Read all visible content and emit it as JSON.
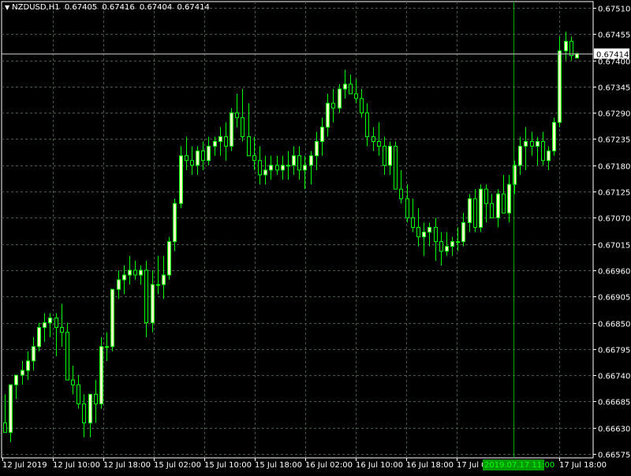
{
  "header": {
    "symbol_tf": "NZDUSD,H1",
    "open": "0.67405",
    "high": "0.67416",
    "low": "0.67404",
    "close": "0.67414"
  },
  "colors": {
    "background": "#000000",
    "grid": "#4a5a4a",
    "bull_candle_fill": "#ffffc8",
    "bull_wick": "#00ff00",
    "bear_candle_fill": "#000000",
    "bear_outline": "#00ff00",
    "axis_text": "#ffffff",
    "price_line": "#c0c0c0",
    "time_marker_line": "#00aa00",
    "time_marker_label_bg": "#009900"
  },
  "chart_data": {
    "type": "candlestick",
    "symbol": "NZDUSD",
    "timeframe": "H1",
    "current_price_label": "0.67414",
    "time_marker_label": "2019.07.17 11:00",
    "y_axis": {
      "ticks": [
        "0.67510",
        "0.67455",
        "0.67400",
        "0.67345",
        "0.67290",
        "0.67235",
        "0.67180",
        "0.67125",
        "0.67070",
        "0.67015",
        "0.66960",
        "0.66905",
        "0.66850",
        "0.66795",
        "0.66740",
        "0.66685",
        "0.66630",
        "0.66575"
      ],
      "ylim": [
        0.66575,
        0.6752
      ]
    },
    "x_axis": {
      "labels": [
        "12 Jul 2019",
        "12 Jul 10:00",
        "12 Jul 18:00",
        "15 Jul 02:00",
        "15 Jul 10:00",
        "15 Jul 18:00",
        "16 Jul 02:00",
        "16 Jul 10:00",
        "16 Jul 18:00",
        "17 Jul 02:00",
        "17 Jul 18:00"
      ]
    },
    "grid": true,
    "candles": [
      [
        0.6664,
        0.667,
        0.6662,
        0.6662
      ],
      [
        0.6662,
        0.6672,
        0.666,
        0.6672
      ],
      [
        0.6672,
        0.6674,
        0.6669,
        0.6674
      ],
      [
        0.6674,
        0.6677,
        0.6672,
        0.6675
      ],
      [
        0.6675,
        0.6679,
        0.6673,
        0.6677
      ],
      [
        0.6677,
        0.6682,
        0.6675,
        0.668
      ],
      [
        0.668,
        0.6685,
        0.6679,
        0.6684
      ],
      [
        0.6684,
        0.6687,
        0.6681,
        0.6685
      ],
      [
        0.6685,
        0.6687,
        0.6682,
        0.6686
      ],
      [
        0.6686,
        0.6687,
        0.6678,
        0.6684
      ],
      [
        0.6684,
        0.6689,
        0.668,
        0.6683
      ],
      [
        0.6683,
        0.6685,
        0.6676,
        0.6673
      ],
      [
        0.6673,
        0.6676,
        0.667,
        0.6672
      ],
      [
        0.6672,
        0.6674,
        0.6667,
        0.6668
      ],
      [
        0.6668,
        0.667,
        0.6661,
        0.6664
      ],
      [
        0.6664,
        0.667,
        0.6661,
        0.667
      ],
      [
        0.667,
        0.6673,
        0.6664,
        0.6668
      ],
      [
        0.6668,
        0.6682,
        0.6667,
        0.668
      ],
      [
        0.668,
        0.6683,
        0.6677,
        0.668
      ],
      [
        0.668,
        0.6692,
        0.6679,
        0.6692
      ],
      [
        0.6692,
        0.6696,
        0.669,
        0.6694
      ],
      [
        0.6694,
        0.6697,
        0.6691,
        0.6695
      ],
      [
        0.6695,
        0.6699,
        0.6693,
        0.6696
      ],
      [
        0.6696,
        0.6698,
        0.6694,
        0.6695
      ],
      [
        0.6695,
        0.6697,
        0.6693,
        0.6696
      ],
      [
        0.6696,
        0.6698,
        0.6682,
        0.6685
      ],
      [
        0.6685,
        0.6696,
        0.6683,
        0.6693
      ],
      [
        0.6693,
        0.6699,
        0.6691,
        0.6693
      ],
      [
        0.6693,
        0.6699,
        0.669,
        0.6695
      ],
      [
        0.6695,
        0.6703,
        0.6694,
        0.6702
      ],
      [
        0.6702,
        0.6711,
        0.67,
        0.671
      ],
      [
        0.671,
        0.6722,
        0.6709,
        0.672
      ],
      [
        0.672,
        0.6724,
        0.6717,
        0.6719
      ],
      [
        0.6719,
        0.6722,
        0.6716,
        0.6718
      ],
      [
        0.6718,
        0.6722,
        0.6716,
        0.6721
      ],
      [
        0.6721,
        0.6723,
        0.6717,
        0.6719
      ],
      [
        0.6719,
        0.6724,
        0.6718,
        0.6722
      ],
      [
        0.6722,
        0.6724,
        0.672,
        0.6723
      ],
      [
        0.6723,
        0.6726,
        0.672,
        0.6724
      ],
      [
        0.6724,
        0.6727,
        0.6719,
        0.6722
      ],
      [
        0.6722,
        0.673,
        0.6721,
        0.6729
      ],
      [
        0.6729,
        0.6733,
        0.6726,
        0.6728
      ],
      [
        0.6728,
        0.6734,
        0.6723,
        0.6724
      ],
      [
        0.6724,
        0.6731,
        0.6721,
        0.672
      ],
      [
        0.672,
        0.6724,
        0.6717,
        0.6719
      ],
      [
        0.6719,
        0.6722,
        0.6714,
        0.6716
      ],
      [
        0.6716,
        0.672,
        0.6714,
        0.6717
      ],
      [
        0.6717,
        0.672,
        0.6715,
        0.6718
      ],
      [
        0.6718,
        0.672,
        0.6716,
        0.6717
      ],
      [
        0.6717,
        0.672,
        0.6715,
        0.6718
      ],
      [
        0.6718,
        0.6721,
        0.6715,
        0.6718
      ],
      [
        0.6718,
        0.6722,
        0.6716,
        0.672
      ],
      [
        0.672,
        0.6722,
        0.6715,
        0.6717
      ],
      [
        0.6717,
        0.672,
        0.6713,
        0.6718
      ],
      [
        0.6718,
        0.6721,
        0.6714,
        0.672
      ],
      [
        0.672,
        0.6725,
        0.6717,
        0.6723
      ],
      [
        0.6723,
        0.6728,
        0.672,
        0.6726
      ],
      [
        0.6726,
        0.6733,
        0.6724,
        0.6731
      ],
      [
        0.6731,
        0.6734,
        0.6727,
        0.673
      ],
      [
        0.673,
        0.6735,
        0.6729,
        0.6734
      ],
      [
        0.6734,
        0.6738,
        0.6732,
        0.6735
      ],
      [
        0.6735,
        0.6737,
        0.6733,
        0.6733
      ],
      [
        0.6733,
        0.6736,
        0.6731,
        0.6732
      ],
      [
        0.6732,
        0.6734,
        0.6728,
        0.6729
      ],
      [
        0.6729,
        0.6731,
        0.6722,
        0.6724
      ],
      [
        0.6724,
        0.6726,
        0.6721,
        0.6723
      ],
      [
        0.6723,
        0.6727,
        0.672,
        0.6722
      ],
      [
        0.6722,
        0.6724,
        0.6716,
        0.6718
      ],
      [
        0.6718,
        0.6723,
        0.6716,
        0.6722
      ],
      [
        0.6722,
        0.6723,
        0.6715,
        0.6713
      ],
      [
        0.6713,
        0.6717,
        0.671,
        0.6711
      ],
      [
        0.6711,
        0.6714,
        0.6706,
        0.6707
      ],
      [
        0.6707,
        0.6711,
        0.6704,
        0.6705
      ],
      [
        0.6705,
        0.6709,
        0.6701,
        0.6703
      ],
      [
        0.6703,
        0.6706,
        0.6699,
        0.6704
      ],
      [
        0.6704,
        0.6706,
        0.6701,
        0.6705
      ],
      [
        0.6705,
        0.6707,
        0.6698,
        0.6702
      ],
      [
        0.6702,
        0.6704,
        0.6697,
        0.67
      ],
      [
        0.67,
        0.6704,
        0.6699,
        0.6701
      ],
      [
        0.6701,
        0.6703,
        0.6699,
        0.6702
      ],
      [
        0.6702,
        0.6705,
        0.67,
        0.6702
      ],
      [
        0.6702,
        0.6708,
        0.6701,
        0.6706
      ],
      [
        0.6706,
        0.6712,
        0.6704,
        0.6711
      ],
      [
        0.6711,
        0.6713,
        0.6704,
        0.6705
      ],
      [
        0.6705,
        0.6714,
        0.6704,
        0.6713
      ],
      [
        0.6713,
        0.6714,
        0.6706,
        0.671
      ],
      [
        0.671,
        0.6712,
        0.6707,
        0.6707
      ],
      [
        0.6707,
        0.6713,
        0.6705,
        0.6712
      ],
      [
        0.6712,
        0.6716,
        0.6708,
        0.6708
      ],
      [
        0.6708,
        0.6716,
        0.6706,
        0.6714
      ],
      [
        0.6714,
        0.6719,
        0.6712,
        0.6718
      ],
      [
        0.6718,
        0.6724,
        0.6716,
        0.6722
      ],
      [
        0.6722,
        0.6726,
        0.6717,
        0.6723
      ],
      [
        0.6723,
        0.6725,
        0.672,
        0.6722
      ],
      [
        0.6722,
        0.6724,
        0.6718,
        0.6723
      ],
      [
        0.6723,
        0.6725,
        0.6718,
        0.6719
      ],
      [
        0.6719,
        0.6722,
        0.6717,
        0.6721
      ],
      [
        0.6721,
        0.6728,
        0.672,
        0.6727
      ],
      [
        0.6727,
        0.6745,
        0.6726,
        0.6742
      ],
      [
        0.6742,
        0.6746,
        0.674,
        0.6744
      ],
      [
        0.6744,
        0.6745,
        0.674,
        0.6741
      ],
      [
        0.67405,
        0.67416,
        0.67404,
        0.67414
      ]
    ]
  }
}
